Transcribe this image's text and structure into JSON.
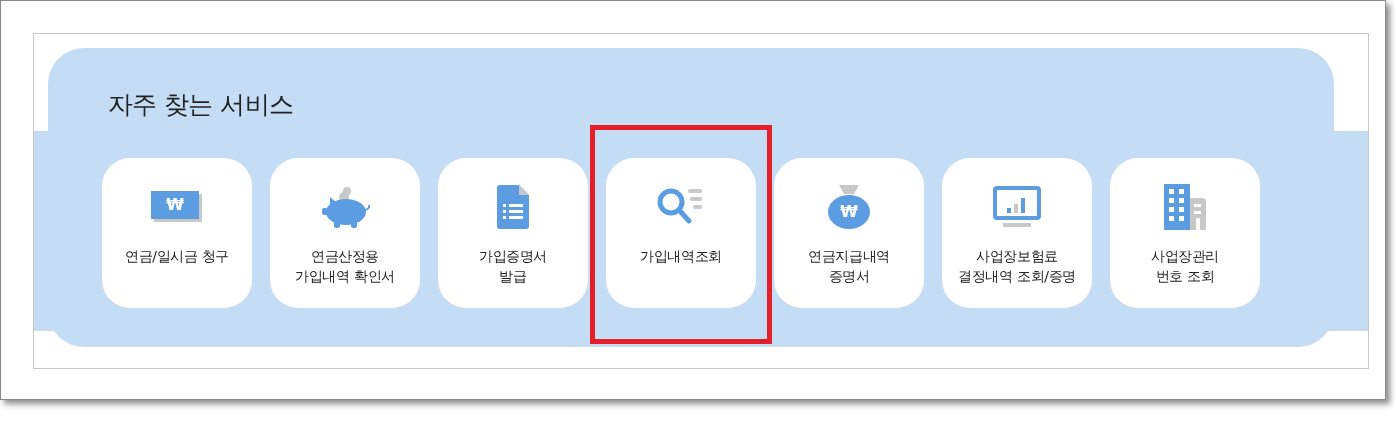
{
  "section": {
    "title": "자주 찾는 서비스"
  },
  "services": [
    {
      "kind": "banknote",
      "symbol": "₩",
      "lines": [
        "연금/일시금 청구"
      ],
      "highlighted": false
    },
    {
      "kind": "piggy",
      "lines": [
        "연금산정용",
        "가입내역 확인서"
      ],
      "highlighted": false
    },
    {
      "kind": "document",
      "lines": [
        "가입증명서",
        "발급"
      ],
      "highlighted": false
    },
    {
      "kind": "search",
      "lines": [
        "가입내역조회"
      ],
      "highlighted": true
    },
    {
      "kind": "moneybag",
      "symbol": "₩",
      "lines": [
        "연금지급내역",
        "증명서"
      ],
      "highlighted": false
    },
    {
      "kind": "monitor",
      "lines": [
        "사업장보험료",
        "결정내역 조회/증명"
      ],
      "highlighted": false
    },
    {
      "kind": "building",
      "lines": [
        "사업장관리",
        "번호 조회"
      ],
      "highlighted": false
    }
  ]
}
